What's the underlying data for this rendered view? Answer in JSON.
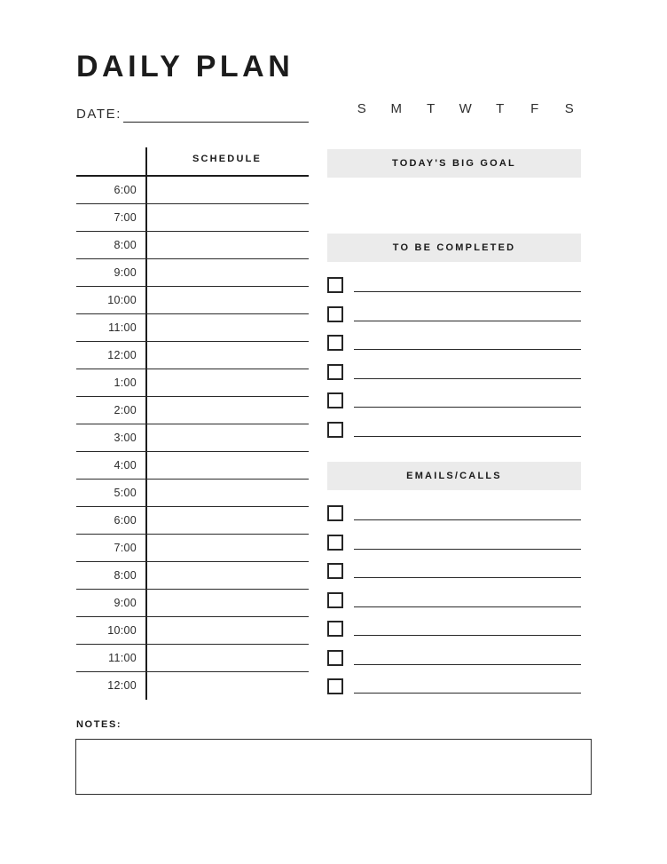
{
  "header": {
    "title": "DAILY PLAN",
    "date_label": "DATE:",
    "date_value": "",
    "weekdays": [
      "S",
      "M",
      "T",
      "W",
      "T",
      "F",
      "S"
    ]
  },
  "schedule": {
    "column_header": "SCHEDULE",
    "times": [
      "6:00",
      "7:00",
      "8:00",
      "9:00",
      "10:00",
      "11:00",
      "12:00",
      "1:00",
      "2:00",
      "3:00",
      "4:00",
      "5:00",
      "6:00",
      "7:00",
      "8:00",
      "9:00",
      "10:00",
      "11:00",
      "12:00"
    ],
    "entries": [
      "",
      "",
      "",
      "",
      "",
      "",
      "",
      "",
      "",
      "",
      "",
      "",
      "",
      "",
      "",
      "",
      "",
      "",
      ""
    ]
  },
  "big_goal": {
    "heading": "TODAY'S BIG GOAL",
    "value": ""
  },
  "to_be_completed": {
    "heading": "TO BE COMPLETED",
    "items": [
      "",
      "",
      "",
      "",
      "",
      ""
    ]
  },
  "emails_calls": {
    "heading": "EMAILS/CALLS",
    "items": [
      "",
      "",
      "",
      "",
      "",
      "",
      ""
    ]
  },
  "notes": {
    "label": "NOTES:",
    "value": ""
  },
  "colors": {
    "band_background": "#ebebeb",
    "ink": "#1a1a1a",
    "rule": "#2a2a2a",
    "page": "#ffffff"
  }
}
